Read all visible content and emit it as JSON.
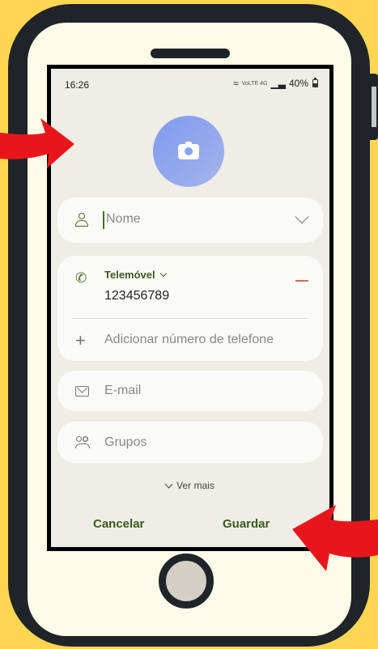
{
  "status_bar": {
    "time": "16:26",
    "network_labels": "VoLTE 4G",
    "battery": "40%"
  },
  "form": {
    "name_placeholder": "Nome",
    "phone_type": "Telemóvel",
    "phone_number": "123456789",
    "add_phone_label": "Adicionar número de telefone",
    "email_placeholder": "E-mail",
    "groups_placeholder": "Grupos",
    "see_more": "Ver mais"
  },
  "actions": {
    "cancel_label": "Cancelar",
    "save_label": "Guardar"
  },
  "colors": {
    "background": "#fed652",
    "phone_frame": "#1e2428",
    "accent": "#3d5a1f",
    "avatar": "#8ba2ee",
    "arrow": "#e8161b"
  }
}
